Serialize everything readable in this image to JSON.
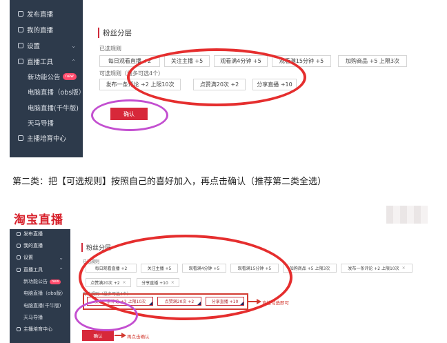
{
  "shot1": {
    "sidebar": [
      {
        "label": "发布直播",
        "icon": "gear-icon"
      },
      {
        "label": "我的直播",
        "icon": "video-icon"
      },
      {
        "label": "设置",
        "icon": "grid-icon",
        "chevron": "⌄"
      },
      {
        "label": "直播工具",
        "icon": "tool-icon",
        "chevron": "⌃"
      },
      {
        "label": "新功能公告",
        "badge": "new"
      },
      {
        "label": "电脑直播（obs版）"
      },
      {
        "label": "电脑直播(千牛版)"
      },
      {
        "label": "天马导播"
      },
      {
        "label": "主播培育中心",
        "icon": "doc-icon"
      }
    ],
    "section_title": "粉丝分层",
    "selected_label": "已选规则",
    "optional_label": "可选规则（最多可选4个）",
    "selected_rules": [
      "每日观看直播 +2",
      "关注主播 +5",
      "观看满4分钟 +5",
      "观看满15分钟 +5",
      "加购商品 +5 上限3次"
    ],
    "optional_rules": [
      "发布一条评论 +2 上限10次",
      "点赞满20次 +2",
      "分享直播 +10"
    ],
    "confirm_label": "确认"
  },
  "caption": "第二类：把【可选规则】按照自己的喜好加入，再点击确认（推荐第二类全选）",
  "shot2": {
    "logo": "淘宝直播",
    "sidebar": [
      {
        "label": "发布直播",
        "icon": "gear-icon"
      },
      {
        "label": "我的直播",
        "icon": "video-icon"
      },
      {
        "label": "设置",
        "icon": "grid-icon",
        "chevron": "⌄"
      },
      {
        "label": "直播工具",
        "icon": "tool-icon",
        "chevron": "⌃"
      },
      {
        "label": "新功能公告",
        "badge": "new"
      },
      {
        "label": "电脑直播（obs版）"
      },
      {
        "label": "电脑直播(千牛版)"
      },
      {
        "label": "天马导播"
      },
      {
        "label": "主播培育中心",
        "icon": "doc-icon"
      }
    ],
    "section_title": "粉丝分层",
    "selected_label": "已选规则",
    "optional_label": "可选规则（最多可选4个）",
    "selected_rules": [
      "每日观看直播 +2",
      "关注主播 +5",
      "观看满4分钟 +5",
      "观看满15分钟 +5",
      "加购商品 +5 上限3次",
      "发布一条评论 +2 上限10次",
      "点赞满20次 +2",
      "分享直播 +10"
    ],
    "optional_rules": [
      "发布一条评论 +2 上限10次",
      "点赞满20次 +2",
      "分享直播 +10"
    ],
    "remove_symbol": "×",
    "confirm_label": "确认",
    "annotation_select": "直接勾选即可",
    "annotation_confirm": "再点击确认"
  },
  "colors": {
    "sidebar_bg": "#2d3a4b",
    "accent_red": "#d7283a",
    "annotation_red": "#e52e2e",
    "annotation_purple": "#c34fd0"
  }
}
